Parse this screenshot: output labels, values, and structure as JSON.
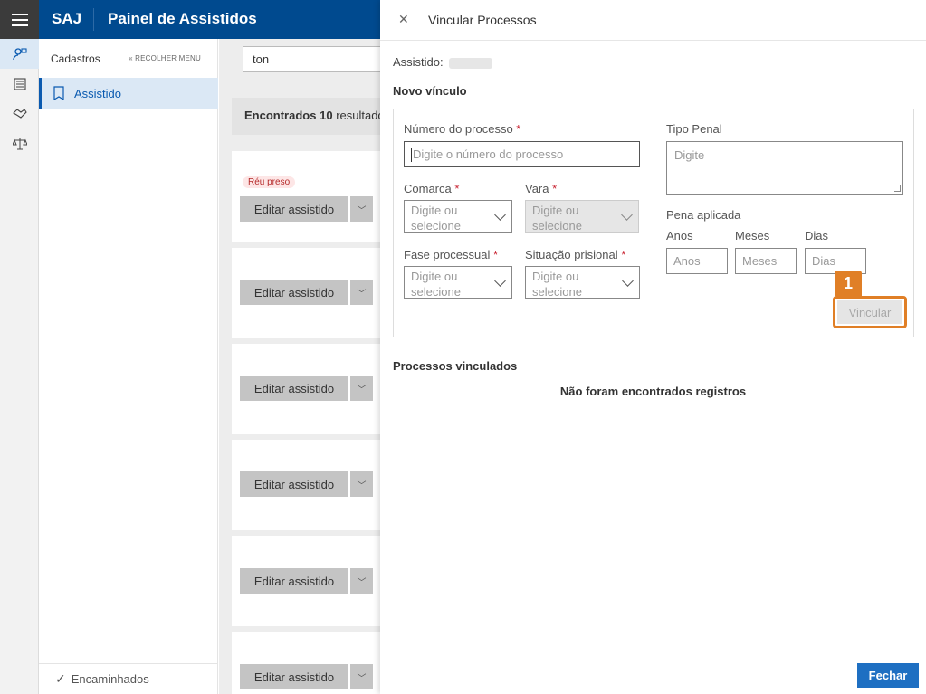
{
  "header": {
    "brand": "SAJ",
    "title": "Painel de Assistidos"
  },
  "rail": {
    "icons": [
      "assistido-icon",
      "list-icon",
      "handshake-icon",
      "scales-icon"
    ]
  },
  "sidebar": {
    "heading": "Cadastros",
    "collapse_label": "RECOLHER MENU",
    "items": [
      {
        "label": "Assistido",
        "icon": "bookmark-icon"
      }
    ],
    "footer_label": "Encaminhados"
  },
  "main": {
    "search_value": "ton",
    "results_count": "10",
    "results_prefix": "Encontrados",
    "results_suffix": "resultado",
    "badge_label": "Réu preso",
    "edit_label": "Editar assistido"
  },
  "panel": {
    "title": "Vincular Processos",
    "assistido_label": "Assistido:",
    "new_link_title": "Novo vínculo",
    "fields": {
      "numero_processo": {
        "label": "Número do processo",
        "required": "*",
        "placeholder": "Digite o número do processo"
      },
      "tipo_penal": {
        "label": "Tipo Penal",
        "placeholder": "Digite"
      },
      "comarca": {
        "label": "Comarca",
        "required": "*",
        "placeholder": "Digite ou selecione"
      },
      "vara": {
        "label": "Vara",
        "required": "*",
        "placeholder": "Digite ou selecione"
      },
      "fase_processual": {
        "label": "Fase processual",
        "required": "*",
        "placeholder": "Digite ou selecione"
      },
      "situacao_prisional": {
        "label": "Situação prisional",
        "required": "*",
        "placeholder": "Digite ou selecione"
      },
      "pena_aplicada": {
        "label": "Pena aplicada"
      },
      "anos": {
        "label": "Anos",
        "placeholder": "Anos"
      },
      "meses": {
        "label": "Meses",
        "placeholder": "Meses"
      },
      "dias": {
        "label": "Dias",
        "placeholder": "Dias"
      }
    },
    "vincular_label": "Vincular",
    "callout_number": "1",
    "linked_title": "Processos vinculados",
    "empty_message": "Não foram encontrados registros",
    "close_label": "Fechar"
  },
  "colors": {
    "header_bg": "#004a8f",
    "accent": "#1e6fc2",
    "highlight": "#e07f26",
    "required": "#c8202f"
  }
}
